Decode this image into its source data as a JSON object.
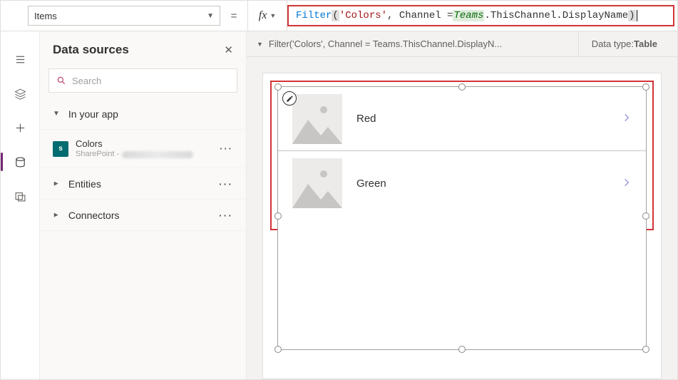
{
  "topbar": {
    "property": "Items",
    "equals": "=",
    "fx": "fx",
    "formula_parts": {
      "fn": "Filter",
      "lp": "(",
      "str": "'Colors'",
      "c1": ", Channel = ",
      "obj": "Teams",
      "tail": ".ThisChannel.DisplayName",
      "rp": ")"
    }
  },
  "infobar": {
    "crumb": "Filter('Colors', Channel = Teams.ThisChannel.DisplayN...",
    "type_label": "Data type: ",
    "type_value": "Table"
  },
  "sidepanel": {
    "title": "Data sources",
    "search_placeholder": "Search",
    "sections": {
      "in_app": "In your app",
      "entities": "Entities",
      "connectors": "Connectors"
    },
    "datasource": {
      "name": "Colors",
      "service": "SharePoint - "
    }
  },
  "gallery": {
    "items": [
      {
        "label": "Red"
      },
      {
        "label": "Green"
      }
    ]
  }
}
